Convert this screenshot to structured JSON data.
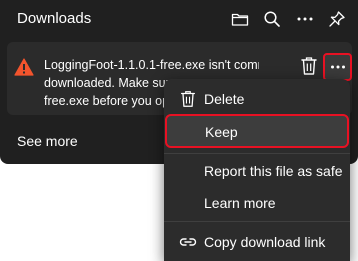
{
  "header": {
    "title": "Downloads",
    "icons": [
      "folder-icon",
      "search-icon",
      "more-icon",
      "pin-icon"
    ]
  },
  "download_item": {
    "message_lines": [
      "LoggingFoot-1.1.0.1-free.exe isn't commonly",
      "downloaded. Make sur",
      "free.exe before you op"
    ],
    "warning_color": "#f2542d"
  },
  "see_more": "See more",
  "context_menu": {
    "delete": "Delete",
    "keep": "Keep",
    "report": "Report this file as safe",
    "learn_more": "Learn more",
    "copy_link": "Copy download link"
  },
  "colors": {
    "panel": "#202020",
    "item": "#2b2b2b",
    "menu": "#2c2c2c",
    "highlight_border": "#e81123"
  }
}
